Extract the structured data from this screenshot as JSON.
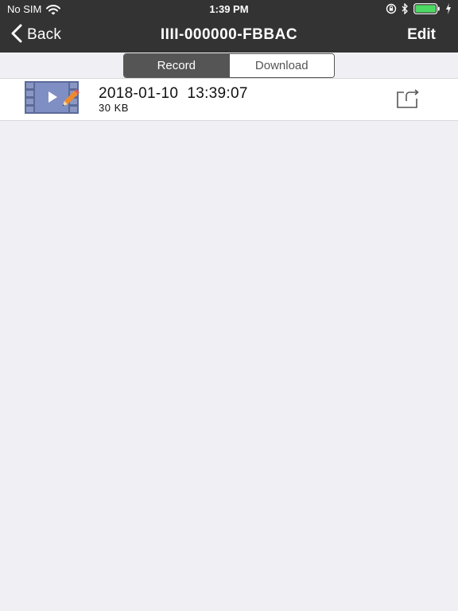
{
  "status_bar": {
    "carrier": "No SIM",
    "time": "1:39 PM",
    "icons": [
      "wifi-icon",
      "orientation-lock-icon",
      "bluetooth-icon",
      "battery-icon",
      "charging-icon"
    ]
  },
  "nav": {
    "back_label": "Back",
    "title": "IIII-000000-FBBAC",
    "edit_label": "Edit"
  },
  "segments": [
    {
      "label": "Record",
      "selected": true
    },
    {
      "label": "Download",
      "selected": false
    }
  ],
  "records": [
    {
      "title": "2018-01-10  13:39:07",
      "size": "30 KB",
      "thumbnail": "video-edit-icon",
      "action_icon": "share-icon"
    }
  ],
  "colors": {
    "bar": "#333333",
    "segment_active": "#555555",
    "background": "#efeff4",
    "battery": "#4cd964",
    "thumb_film": "#5b6a99",
    "thumb_screen": "#7f8fc4"
  }
}
